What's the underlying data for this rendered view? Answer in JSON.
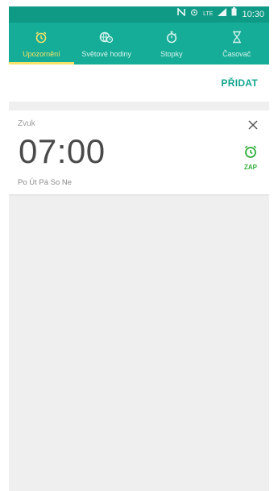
{
  "status_bar": {
    "time": "10:30",
    "icons": [
      "nfc-icon",
      "alarm-icon",
      "lte-icon",
      "signal-icon",
      "battery-icon"
    ],
    "network_label": "LTE"
  },
  "tabs": [
    {
      "label": "Upozornění",
      "icon": "alarm-clock-icon",
      "active": true
    },
    {
      "label": "Světové hodiny",
      "icon": "world-clock-icon",
      "active": false
    },
    {
      "label": "Stopky",
      "icon": "stopwatch-icon",
      "active": false
    },
    {
      "label": "Časovač",
      "icon": "hourglass-icon",
      "active": false
    }
  ],
  "actions": {
    "add_label": "PŘIDAT"
  },
  "alarm": {
    "label": "Zvuk",
    "time": "07:00",
    "days": "Po Út Pá So Ne",
    "toggle_label": "ZAP"
  },
  "colors": {
    "status_bar": "#0f9a86",
    "tab_bar": "#15ad97",
    "active_tab": "#f5e26a",
    "accent": "#12a48f",
    "alarm_on": "#2fae3b",
    "background": "#efefef"
  }
}
